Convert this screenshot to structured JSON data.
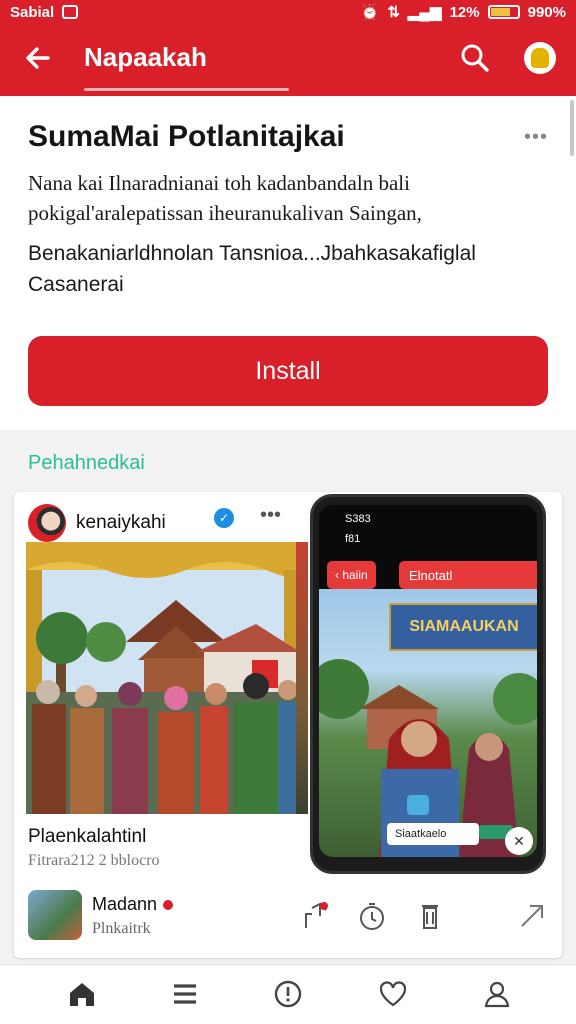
{
  "status_bar": {
    "carrier": "Sabial",
    "signal_text": "12%",
    "battery_text": "990%"
  },
  "app_bar": {
    "title": "Napaakah"
  },
  "app": {
    "name": "SumaMai Potlanitajkai",
    "description": "Nana kai Ilnaradnianai  toh kadanbandaln bali pokigal'aralepatissan iheuranukalivan Saingan,",
    "details": "Benakaniarldhnolan Tansnioa...Jbahkasakafiglal Casanerai",
    "install_label": "Install"
  },
  "section": {
    "label": "Pehahnedkai"
  },
  "post": {
    "author": "kenaiykahi",
    "caption": "Plaenkalahtinl",
    "meta": "Fitrara212  2  bblocro",
    "phone_time": "S383",
    "phone_sub": "f81",
    "phone_pill1": "‹ haiin",
    "phone_pill2": "Elnotatl",
    "phone_banner": "SIAMAAUKAN",
    "phone_chip": "Siaatkaelo"
  },
  "related": {
    "title": "Madann",
    "subtitle": "Plnkaitrk"
  },
  "colors": {
    "brand": "#d81f2a",
    "accent": "#2bbd9a"
  }
}
